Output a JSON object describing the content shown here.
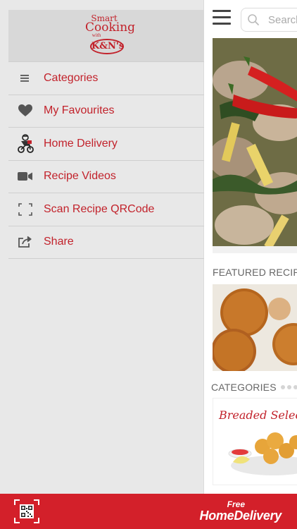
{
  "main": {
    "search": {
      "placeholder": "Search"
    },
    "featured_title": "FEATURED RECIPES",
    "categories_title": "CATEGORIES",
    "category_card_text": "Breaded Selection"
  },
  "drawer": {
    "logo": {
      "line1": "Smart",
      "line2": "Cooking",
      "line3": "with",
      "brand": "K&N's"
    },
    "items": [
      {
        "label": "Categories",
        "icon": "list-icon"
      },
      {
        "label": "My Favourites",
        "icon": "heart-icon"
      },
      {
        "label": "Home Delivery",
        "icon": "delivery-rider-icon"
      },
      {
        "label": "Recipe Videos",
        "icon": "video-camera-icon"
      },
      {
        "label": "Scan Recipe QRCode",
        "icon": "scan-frame-icon"
      },
      {
        "label": "Share",
        "icon": "share-icon"
      }
    ]
  },
  "bottom_bar": {
    "free_label": "Free",
    "home_delivery_label": "HomeDelivery"
  },
  "colors": {
    "brand_red": "#c2222b",
    "bar_red": "#d3202a",
    "drawer_bg": "#e8e8e8"
  }
}
